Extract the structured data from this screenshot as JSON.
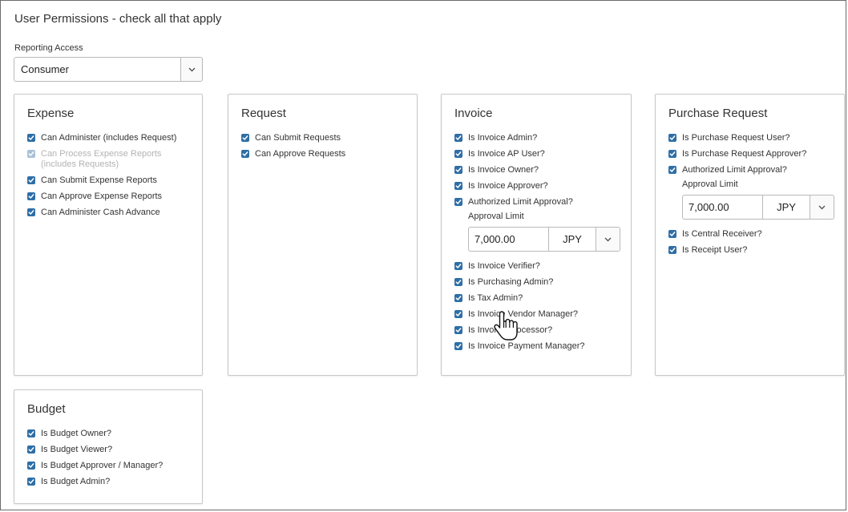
{
  "header": {
    "title": "User Permissions - check all that apply",
    "reporting_label": "Reporting Access",
    "reporting_value": "Consumer"
  },
  "icons": {
    "checkbox": "checkbox-checked-icon",
    "dropdown": "chevron-down-icon",
    "cursor": "hand-pointer-icon"
  },
  "colors": {
    "checkbox": "#2f6ea5",
    "checkbox_disabled": "#a9c1d6",
    "border": "#c8c8c8"
  },
  "expense": {
    "title": "Expense",
    "items": [
      {
        "label": "Can Administer (includes Request)",
        "checked": true
      },
      {
        "label": "Can Process Expense Reports (includes Requests)",
        "checked": true,
        "disabled": true
      },
      {
        "label": "Can Submit Expense Reports",
        "checked": true
      },
      {
        "label": "Can Approve Expense Reports",
        "checked": true
      },
      {
        "label": "Can Administer Cash Advance",
        "checked": true
      }
    ]
  },
  "request": {
    "title": "Request",
    "items": [
      {
        "label": "Can Submit Requests",
        "checked": true
      },
      {
        "label": "Can Approve Requests",
        "checked": true
      }
    ]
  },
  "invoice": {
    "title": "Invoice",
    "items_top": [
      {
        "label": "Is Invoice Admin?",
        "checked": true
      },
      {
        "label": "Is Invoice AP User?",
        "checked": true
      },
      {
        "label": "Is Invoice Owner?",
        "checked": true
      },
      {
        "label": "Is Invoice Approver?",
        "checked": true
      },
      {
        "label": "Authorized Limit Approval?",
        "checked": true
      }
    ],
    "limit_label": "Approval Limit",
    "limit_amount": "7,000.00",
    "limit_currency": "JPY",
    "items_bottom": [
      {
        "label": "Is Invoice Verifier?",
        "checked": true
      },
      {
        "label": "Is Purchasing Admin?",
        "checked": true
      },
      {
        "label": "Is Tax Admin?",
        "checked": true
      },
      {
        "label": "Is Invoice Vendor Manager?",
        "checked": true
      },
      {
        "label": "Is Invoice Processor?",
        "checked": true
      },
      {
        "label": "Is Invoice Payment Manager?",
        "checked": true
      }
    ]
  },
  "purchase_request": {
    "title": "Purchase Request",
    "items_top": [
      {
        "label": "Is Purchase Request User?",
        "checked": true
      },
      {
        "label": "Is Purchase Request Approver?",
        "checked": true
      },
      {
        "label": "Authorized Limit Approval?",
        "checked": true
      }
    ],
    "limit_label": "Approval Limit",
    "limit_amount": "7,000.00",
    "limit_currency": "JPY",
    "items_bottom": [
      {
        "label": "Is Central Receiver?",
        "checked": true
      },
      {
        "label": "Is Receipt User?",
        "checked": true
      }
    ]
  },
  "budget": {
    "title": "Budget",
    "items": [
      {
        "label": "Is Budget Owner?",
        "checked": true
      },
      {
        "label": "Is Budget Viewer?",
        "checked": true
      },
      {
        "label": "Is Budget Approver / Manager?",
        "checked": true
      },
      {
        "label": "Is Budget Admin?",
        "checked": true
      }
    ]
  }
}
